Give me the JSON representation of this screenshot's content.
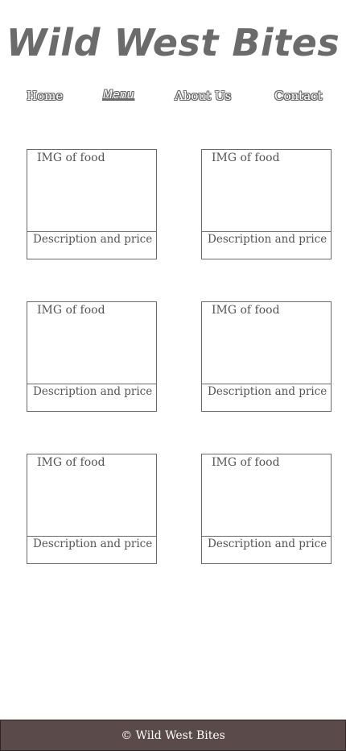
{
  "header": {
    "title": "Wild West Bites"
  },
  "nav": {
    "items": [
      {
        "label": "Home",
        "active": false
      },
      {
        "label": "Menu",
        "active": true
      },
      {
        "label": "About Us",
        "active": false
      },
      {
        "label": "Contact",
        "active": false
      }
    ]
  },
  "menu": {
    "items": [
      {
        "image_label": "IMG of food",
        "description": "Description and price"
      },
      {
        "image_label": "IMG of food",
        "description": "Description and price"
      },
      {
        "image_label": "IMG of food",
        "description": "Description and price"
      },
      {
        "image_label": "IMG of food",
        "description": "Description and price"
      },
      {
        "image_label": "IMG of food",
        "description": "Description and price"
      },
      {
        "image_label": "IMG of food",
        "description": "Description and price"
      }
    ]
  },
  "footer": {
    "text": "© Wild West Bites"
  },
  "colors": {
    "title": "#6b6b6b",
    "footer_bg": "#5a4a4a",
    "border": "#6b6b6b"
  }
}
